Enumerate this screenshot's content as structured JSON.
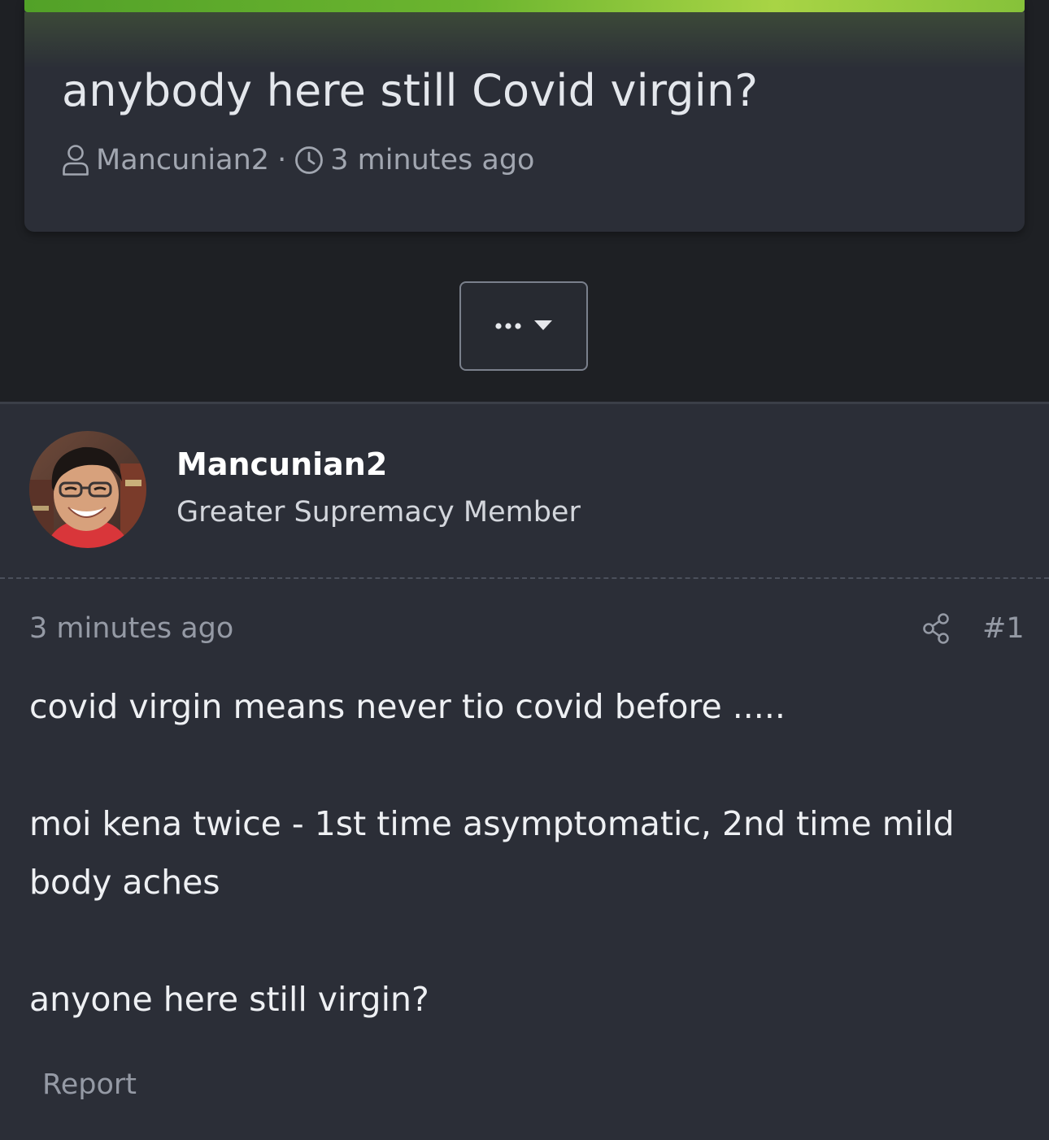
{
  "thread": {
    "title": "anybody here still Covid virgin?",
    "author": "Mancunian2",
    "separator": "·",
    "time": "3 minutes ago",
    "icons": {
      "author": "user-icon",
      "time": "clock-icon"
    }
  },
  "thread_menu": {
    "icon": "ellipsis-icon",
    "dropdown_icon": "caret-down-icon"
  },
  "post": {
    "author_name": "Mancunian2",
    "author_title": "Greater Supremacy Member",
    "time": "3 minutes ago",
    "number": "#1",
    "share_icon": "share-icon",
    "body": [
      "covid virgin means never tio covid before .....",
      "moi kena twice - 1st time asymptomatic, 2nd time mild body aches",
      "anyone here still virgin?"
    ],
    "report_label": "Report"
  },
  "colors": {
    "accent": "#6cb52f",
    "background": "#1e2024",
    "card": "#2b2e37",
    "muted_text": "#959aa5"
  }
}
